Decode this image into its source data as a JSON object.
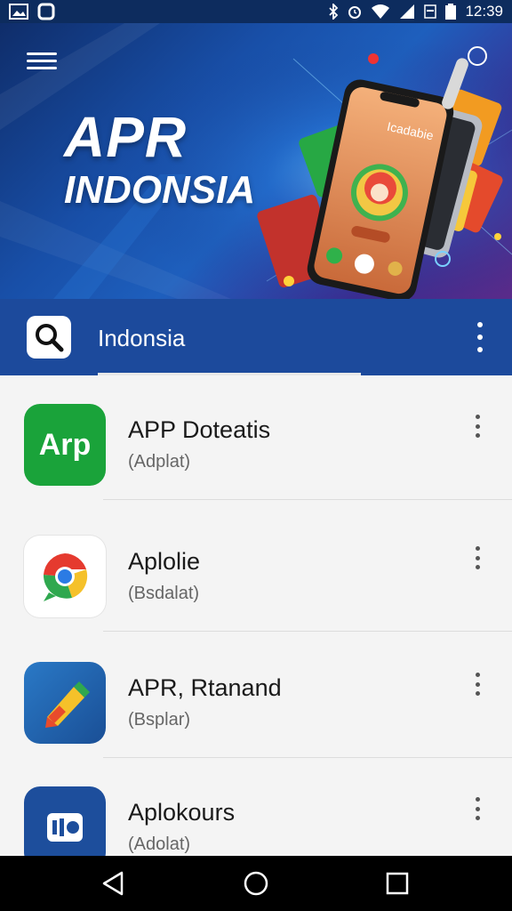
{
  "status_bar": {
    "time": "12:39"
  },
  "hero": {
    "title_line1": "APR",
    "title_line2": "INDONSIA",
    "phone_screen_text": "Icadabie"
  },
  "search": {
    "value": "Indonsia"
  },
  "apps": [
    {
      "name": "APP Doteatis",
      "subtitle": "(Adplat)",
      "icon": "arp-green-icon",
      "icon_text": "Arp",
      "color": "#1aa33a"
    },
    {
      "name": "Aplolie",
      "subtitle": "(Bsdalat)",
      "icon": "chrome-chat-icon",
      "color": "#ffffff"
    },
    {
      "name": "APR, Rtanand",
      "subtitle": "(Bsplar)",
      "icon": "pencil-app-icon",
      "color": "#1f5fa8"
    },
    {
      "name": "Aplokours",
      "subtitle": "(Adolat)",
      "icon": "outlook-style-icon",
      "color": "#1d4e9c"
    }
  ],
  "nav": {
    "back": "back-icon",
    "home": "home-icon",
    "recents": "recents-icon"
  }
}
